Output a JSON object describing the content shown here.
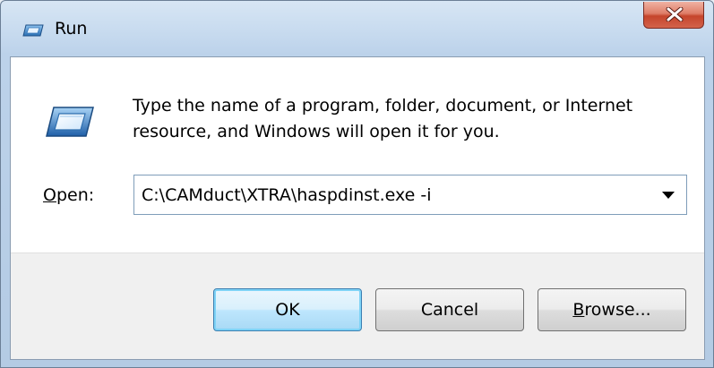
{
  "window": {
    "title": "Run",
    "close_icon": "close-icon",
    "app_icon": "run-icon"
  },
  "dialog": {
    "description": "Type the name of a program, folder, document, or Internet resource, and Windows will open it for you.",
    "open_label_accel": "O",
    "open_label_rest": "pen:",
    "command_value": "C:\\CAMduct\\XTRA\\haspdinst.exe -i"
  },
  "buttons": {
    "ok": "OK",
    "cancel": "Cancel",
    "browse_accel": "B",
    "browse_rest": "rowse..."
  },
  "colors": {
    "close_button": "#c5452c",
    "default_button_border": "#3c7fb1"
  }
}
